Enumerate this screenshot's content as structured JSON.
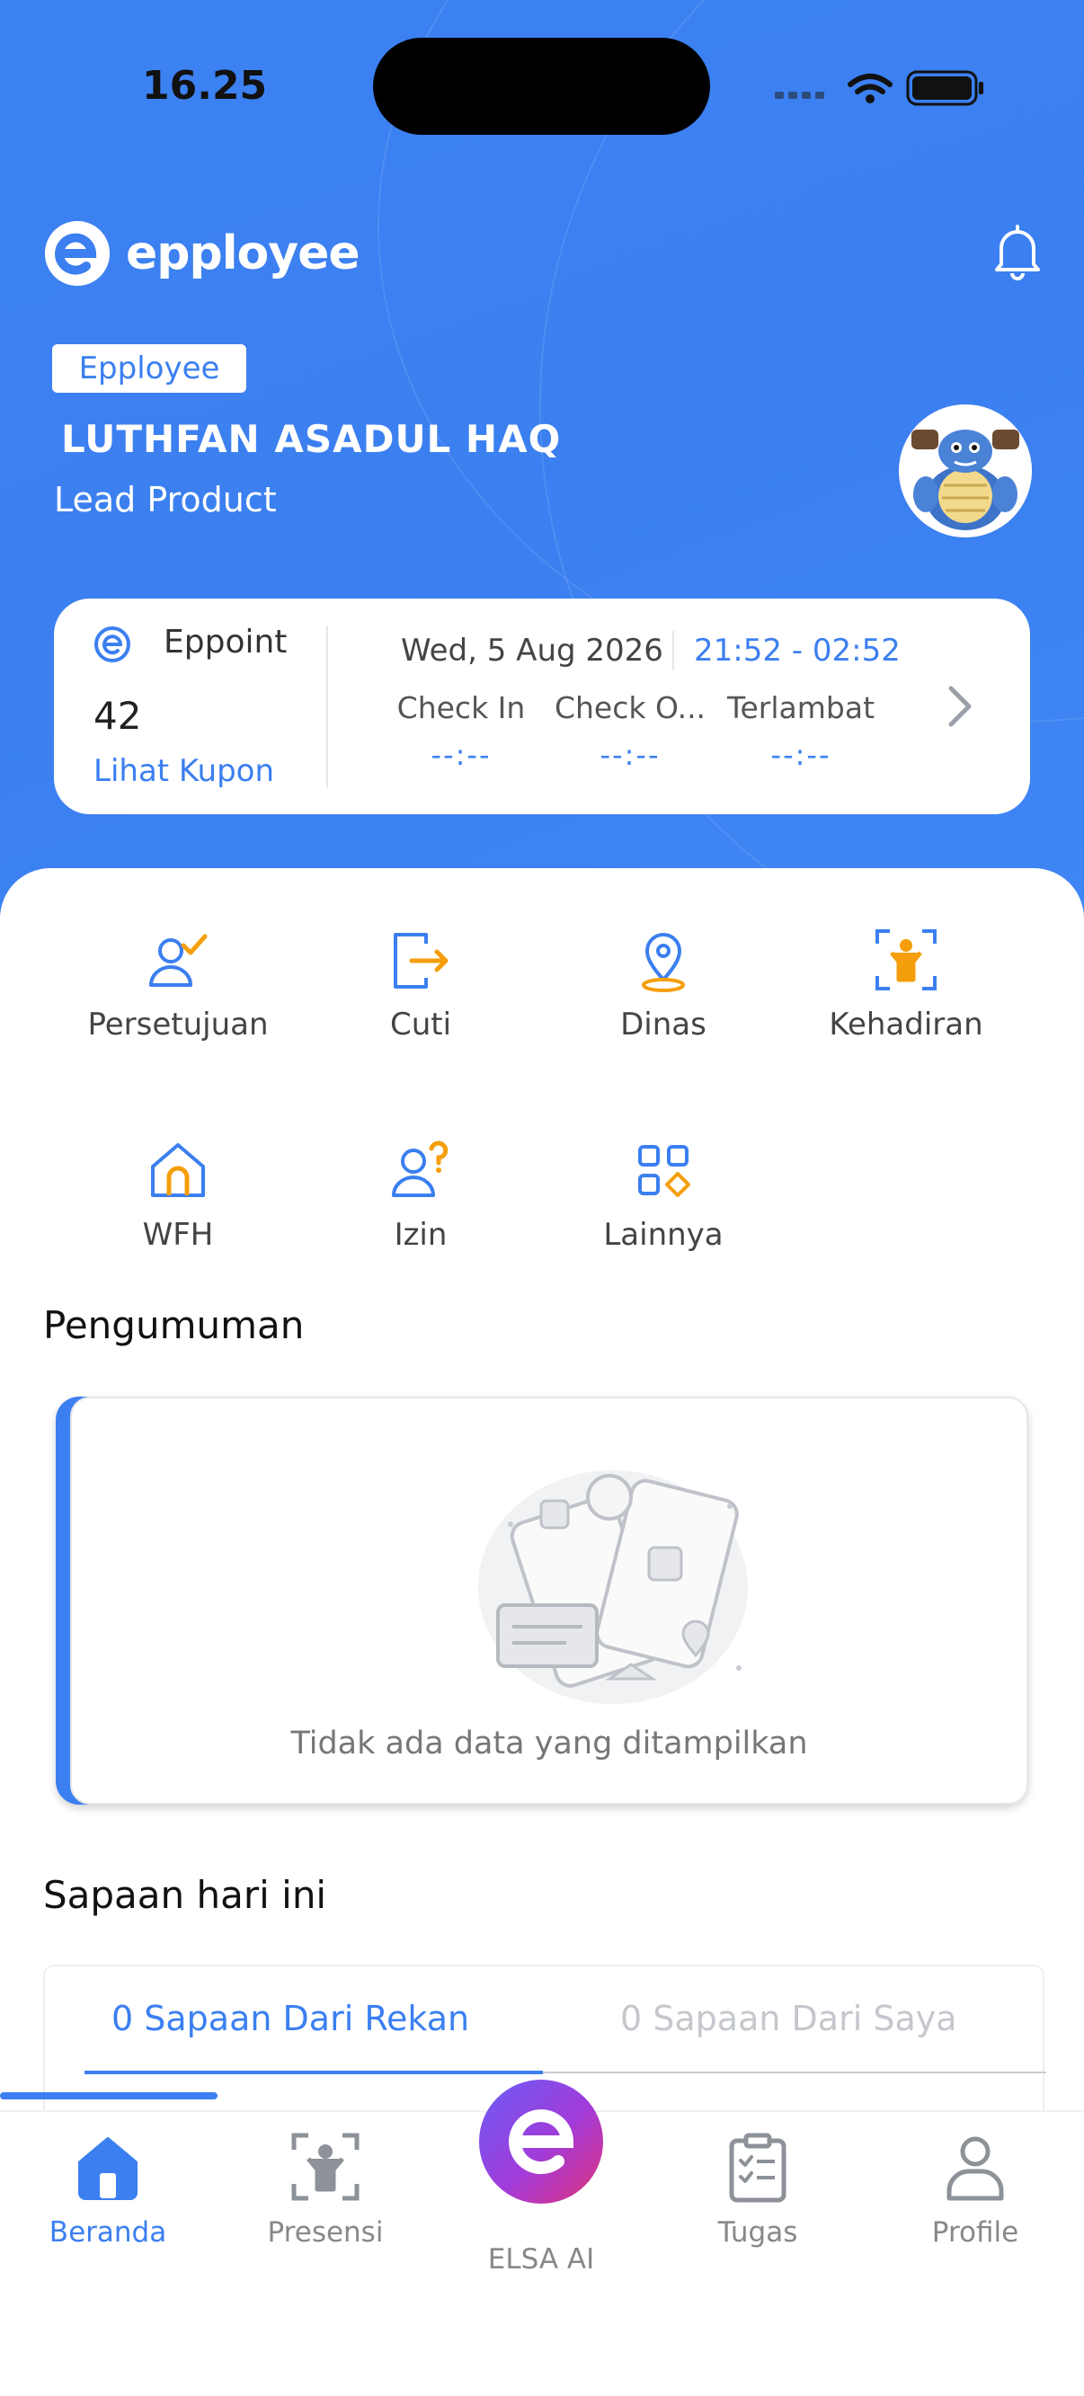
{
  "status_bar": {
    "time": "16.25"
  },
  "brand": {
    "name": "epployee"
  },
  "profile": {
    "company_badge": "Epployee",
    "name": "LUTHFAN ASADUL HAQ",
    "role": "Lead Product"
  },
  "eppoint": {
    "title": "Eppoint",
    "points": "42",
    "link": "Lihat Kupon"
  },
  "attendance": {
    "date": "Wed, 5 Aug 2026",
    "time_range": "21:52 - 02:52",
    "columns": [
      {
        "label": "Check In",
        "value": "--:--"
      },
      {
        "label": "Check O...",
        "value": "--:--"
      },
      {
        "label": "Terlambat",
        "value": "--:--"
      }
    ]
  },
  "menu": {
    "items": [
      {
        "label": "Persetujuan",
        "icon": "approval-icon"
      },
      {
        "label": "Cuti",
        "icon": "leave-icon"
      },
      {
        "label": "Dinas",
        "icon": "location-pin-icon"
      },
      {
        "label": "Kehadiran",
        "icon": "attendance-scan-icon"
      },
      {
        "label": "WFH",
        "icon": "home-icon"
      },
      {
        "label": "Izin",
        "icon": "permission-icon"
      },
      {
        "label": "Lainnya",
        "icon": "more-grid-icon"
      }
    ]
  },
  "announcements": {
    "title": "Pengumuman",
    "empty_text": "Tidak ada data yang ditampilkan"
  },
  "greetings": {
    "title": "Sapaan hari ini",
    "tabs": [
      {
        "label": "0 Sapaan Dari Rekan",
        "active": true
      },
      {
        "label": "0 Sapaan Dari Saya",
        "active": false
      }
    ]
  },
  "bottom_nav": {
    "items": [
      {
        "label": "Beranda",
        "icon": "home-filled-icon",
        "active": true
      },
      {
        "label": "Presensi",
        "icon": "presence-icon",
        "active": false
      },
      {
        "label": "ELSA AI",
        "icon": "elsa-ai-icon",
        "active": false
      },
      {
        "label": "Tugas",
        "icon": "tasks-clipboard-icon",
        "active": false
      },
      {
        "label": "Profile",
        "icon": "profile-icon",
        "active": false
      }
    ]
  },
  "colors": {
    "primary": "#3b7ff0",
    "accent_orange": "#f59e0b",
    "header_bg": "#3d82f2",
    "text_dark": "#111111",
    "text_muted": "#888888"
  }
}
